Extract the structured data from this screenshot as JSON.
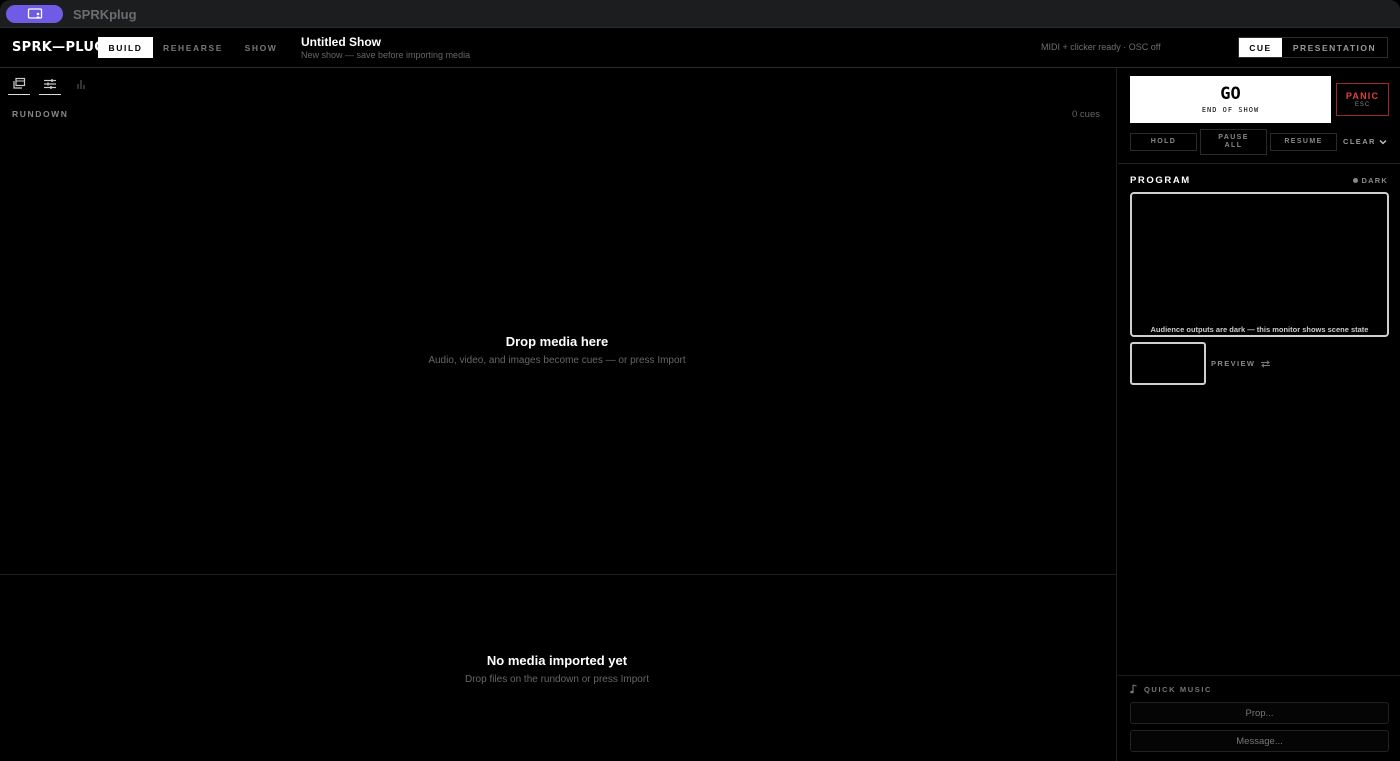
{
  "titlebar": {
    "app_icon": "laptop-person-icon",
    "app_name": "SPRKplug",
    "accent": "#6f5be6"
  },
  "header": {
    "brand": "SPRK—PLUG",
    "modes": [
      "BUILD",
      "REHEARSE",
      "SHOW"
    ],
    "active_mode": "BUILD",
    "show_title": "Untitled Show",
    "show_subtitle": "New show — save before importing media",
    "status": "MIDI + clicker ready · OSC off",
    "views": [
      "CUE",
      "PRESENTATION"
    ],
    "active_view": "CUE"
  },
  "left_panel": {
    "tools": [
      "layers-icon",
      "sliders-icon",
      "bar-chart-icon"
    ],
    "rundown_label": "RUNDOWN",
    "cue_count": "0 cues",
    "drop_title": "Drop media here",
    "drop_subtitle": "Audio, video, and images become cues — or press Import",
    "media_title": "No media imported yet",
    "media_subtitle": "Drop files on the rundown or press Import"
  },
  "right_panel": {
    "go_label": "GO",
    "go_sublabel": "END OF SHOW",
    "panic_label": "PANIC",
    "panic_sublabel": "ESC",
    "panic_color": "#e0413a",
    "controls": {
      "hold": "HOLD",
      "pause_all_1": "PAUSE",
      "pause_all_2": "ALL",
      "resume": "RESUME",
      "clear": "CLEAR"
    },
    "program_label": "PROGRAM",
    "dark_indicator": "DARK",
    "monitor_caption": "Audience outputs are dark — this monitor shows scene state",
    "preview_label": "PREVIEW",
    "quick_music_label": "QUICK MUSIC",
    "prop_placeholder": "Prop...",
    "message_placeholder": "Message..."
  }
}
